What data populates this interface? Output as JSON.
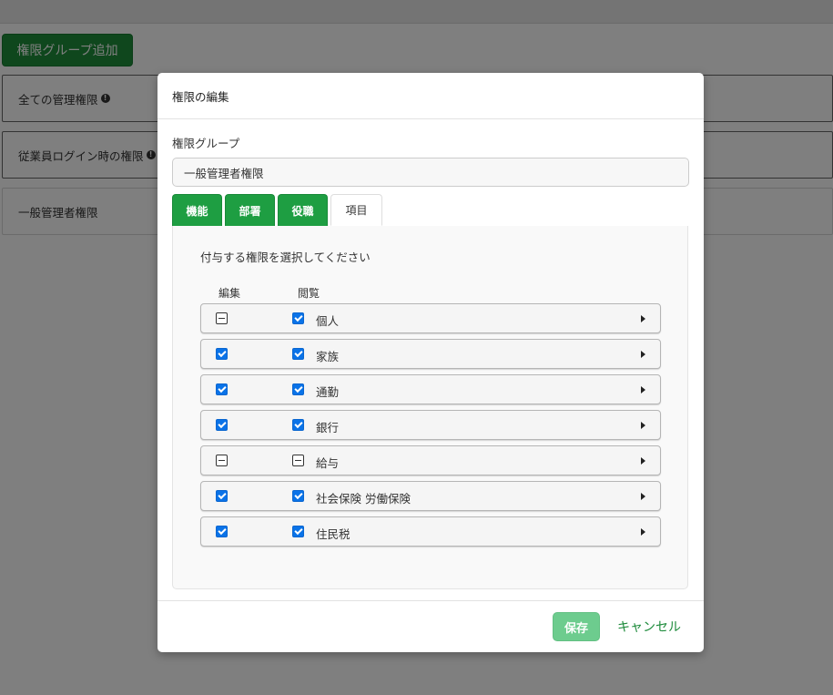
{
  "background": {
    "add_group_button": "権限グループ追加",
    "rows": [
      {
        "label": "全ての管理権限",
        "info": "!"
      },
      {
        "label": "従業員ログイン時の権限",
        "info": "!"
      },
      {
        "label": "一般管理者権限"
      }
    ]
  },
  "modal": {
    "title": "権限の編集",
    "group_field_label": "権限グループ",
    "group_value": "一般管理者権限",
    "tabs": [
      {
        "label": "機能",
        "active": false
      },
      {
        "label": "部署",
        "active": false
      },
      {
        "label": "役職",
        "active": false
      },
      {
        "label": "項目",
        "active": true
      }
    ],
    "instruction": "付与する権限を選択してください",
    "columns": {
      "edit": "編集",
      "view": "閲覧"
    },
    "items": [
      {
        "label": "個人",
        "edit": "indeterminate",
        "view": "checked"
      },
      {
        "label": "家族",
        "edit": "checked",
        "view": "checked"
      },
      {
        "label": "通勤",
        "edit": "checked",
        "view": "checked"
      },
      {
        "label": "銀行",
        "edit": "checked",
        "view": "checked"
      },
      {
        "label": "給与",
        "edit": "indeterminate",
        "view": "indeterminate"
      },
      {
        "label": "社会保険 労働保険",
        "edit": "checked",
        "view": "checked"
      },
      {
        "label": "住民税",
        "edit": "checked",
        "view": "checked"
      }
    ],
    "footer": {
      "save_label": "保存",
      "cancel_label": "キャンセル"
    }
  },
  "colors": {
    "primary_green": "#1e9e42",
    "checkbox_blue": "#0a73e8",
    "save_disabled": "#6dcc8e"
  }
}
